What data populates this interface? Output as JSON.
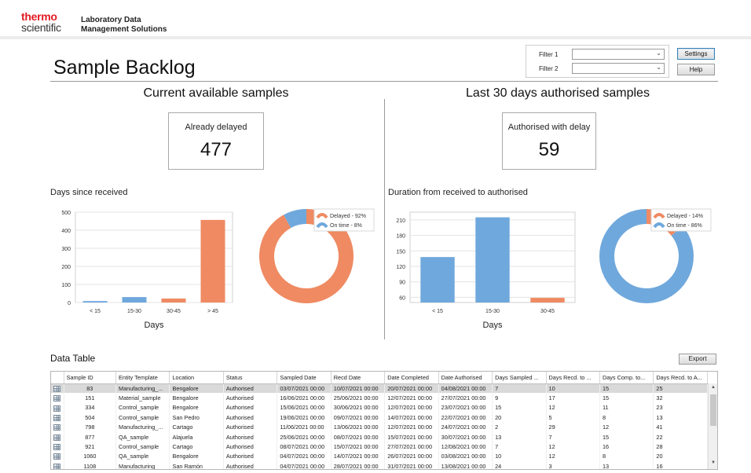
{
  "header": {
    "logo_line1": "thermo",
    "logo_line2": "scientific",
    "app_title_line1": "Laboratory Data",
    "app_title_line2": "Management Solutions"
  },
  "page": {
    "title": "Sample Backlog"
  },
  "filters": {
    "filter1_label": "Filter 1",
    "filter2_label": "Filter 2",
    "filter1_value": "",
    "filter2_value": ""
  },
  "buttons": {
    "settings": "Settings",
    "help": "Help",
    "export": "Export"
  },
  "left_section": {
    "title": "Current available samples",
    "kpi_label": "Already delayed",
    "kpi_value": "477",
    "chart_title": "Days since received"
  },
  "right_section": {
    "title": "Last 30 days authorised samples",
    "kpi_label": "Authorised with delay",
    "kpi_value": "59",
    "chart_title": "Duration from received to authorised"
  },
  "colors": {
    "orange": "#ef8a62",
    "blue": "#6fa8dc"
  },
  "chart_data": [
    {
      "type": "bar",
      "categories": [
        "< 15",
        "15-30",
        "30-45",
        "> 45"
      ],
      "values": [
        8,
        30,
        22,
        457
      ],
      "bar_colors": [
        "#6fa8dc",
        "#6fa8dc",
        "#ef8a62",
        "#ef8a62"
      ],
      "xlabel": "Days",
      "ylabel": "",
      "ylim": [
        0,
        500
      ],
      "yticks": [
        "0",
        "100",
        "200",
        "300",
        "400",
        "500"
      ],
      "grid": true
    },
    {
      "type": "pie",
      "donut": true,
      "slices": [
        {
          "label": "Delayed - 92%",
          "value": 92,
          "color": "#ef8a62"
        },
        {
          "label": "On time - 8%",
          "value": 8,
          "color": "#6fa8dc"
        }
      ],
      "legend_position": "top-right"
    },
    {
      "type": "bar",
      "categories": [
        "< 15",
        "15-30",
        "30-45"
      ],
      "values": [
        138,
        215,
        59
      ],
      "bar_colors": [
        "#6fa8dc",
        "#6fa8dc",
        "#ef8a62"
      ],
      "xlabel": "Days",
      "ylabel": "",
      "ylim": [
        50,
        225
      ],
      "yticks": [
        "60",
        "90",
        "120",
        "150",
        "180",
        "210"
      ],
      "grid": true
    },
    {
      "type": "pie",
      "donut": true,
      "slices": [
        {
          "label": "Delayed - 14%",
          "value": 14,
          "color": "#ef8a62"
        },
        {
          "label": "On time - 86%",
          "value": 86,
          "color": "#6fa8dc"
        }
      ],
      "legend_position": "top-right"
    }
  ],
  "data_table": {
    "title": "Data Table",
    "columns": [
      "Sample ID",
      "Entity Template",
      "Location",
      "Status",
      "Sampled Date",
      "Recd Date",
      "Date Completed",
      "Date Authorised",
      "Days Sampled ...",
      "Days Recd. to ...",
      "Days Comp. to...",
      "Days Recd. to A..."
    ],
    "rows": [
      [
        "83",
        "Manufacturing_...",
        "Bengalore",
        "Authorised",
        "03/07/2021 00:00",
        "10/07/2021 00:00",
        "20/07/2021 00:00",
        "04/08/2021 00:00",
        "7",
        "10",
        "15",
        "25"
      ],
      [
        "151",
        "Material_sample",
        "Bengalore",
        "Authorised",
        "16/06/2021 00:00",
        "25/06/2021 00:00",
        "12/07/2021 00:00",
        "27/07/2021 00:00",
        "9",
        "17",
        "15",
        "32"
      ],
      [
        "334",
        "Control_sample",
        "Bengalore",
        "Authorised",
        "15/06/2021 00:00",
        "30/06/2021 00:00",
        "12/07/2021 00:00",
        "23/07/2021 00:00",
        "15",
        "12",
        "11",
        "23"
      ],
      [
        "504",
        "Control_sample",
        "San Pedro",
        "Authorised",
        "19/06/2021 00:00",
        "09/07/2021 00:00",
        "14/07/2021 00:00",
        "22/07/2021 00:00",
        "20",
        "5",
        "8",
        "13"
      ],
      [
        "798",
        "Manufacturing_...",
        "Cartago",
        "Authorised",
        "11/06/2021 00:00",
        "13/06/2021 00:00",
        "12/07/2021 00:00",
        "24/07/2021 00:00",
        "2",
        "29",
        "12",
        "41"
      ],
      [
        "877",
        "QA_sample",
        "Alajuela",
        "Authorised",
        "25/06/2021 00:00",
        "08/07/2021 00:00",
        "15/07/2021 00:00",
        "30/07/2021 00:00",
        "13",
        "7",
        "15",
        "22"
      ],
      [
        "921",
        "Control_sample",
        "Cartago",
        "Authorised",
        "08/07/2021 00:00",
        "15/07/2021 00:00",
        "27/07/2021 00:00",
        "12/08/2021 00:00",
        "7",
        "12",
        "16",
        "28"
      ],
      [
        "1060",
        "QA_sample",
        "Bengalore",
        "Authorised",
        "04/07/2021 00:00",
        "14/07/2021 00:00",
        "26/07/2021 00:00",
        "03/08/2021 00:00",
        "10",
        "12",
        "8",
        "20"
      ],
      [
        "1108",
        "Manufacturing",
        "San Ramón",
        "Authorised",
        "04/07/2021 00:00",
        "28/07/2021 00:00",
        "31/07/2021 00:00",
        "13/08/2021 00:00",
        "24",
        "3",
        "13",
        "16"
      ]
    ]
  }
}
